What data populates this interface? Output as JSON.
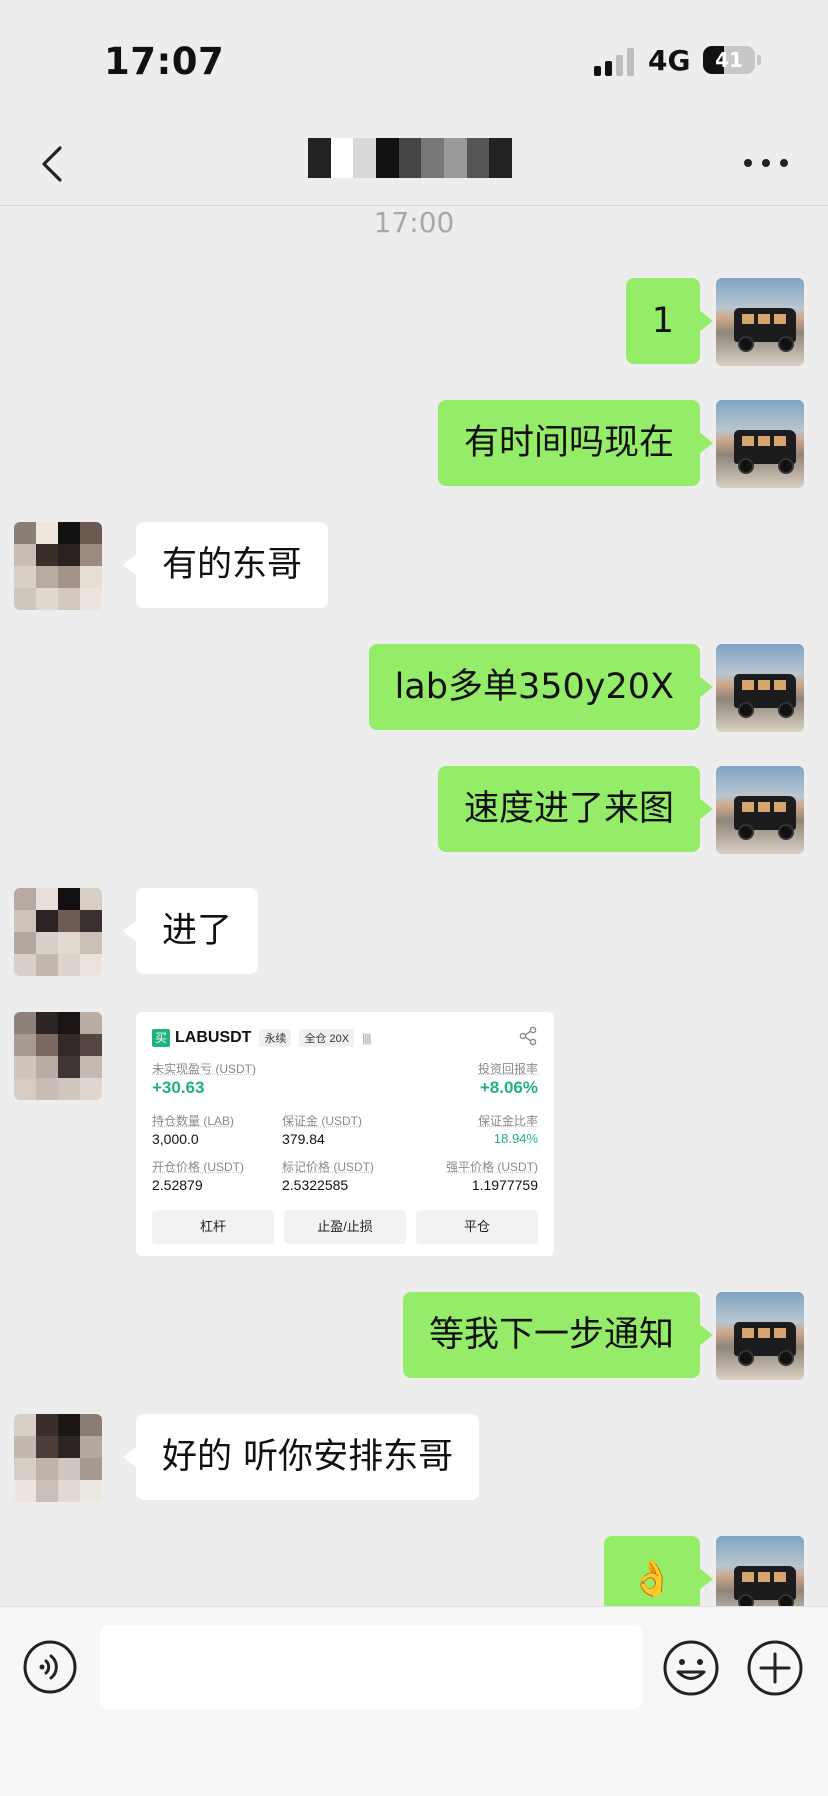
{
  "status_bar": {
    "time": "17:07",
    "network": "4G",
    "battery": "41",
    "battery_level": 0.41
  },
  "header": {
    "back_icon": "chevron-left-icon",
    "more_icon": "more-dots-icon"
  },
  "chat": {
    "timestamp": "17:00",
    "messages": [
      {
        "side": "right",
        "text": "1"
      },
      {
        "side": "right",
        "text": "有时间吗现在"
      },
      {
        "side": "left",
        "text": "有的东哥"
      },
      {
        "side": "right",
        "text": "lab多单350y20X"
      },
      {
        "side": "right",
        "text": "速度进了来图"
      },
      {
        "side": "left",
        "text": "进了"
      },
      {
        "side": "left",
        "type": "trade-card"
      },
      {
        "side": "right",
        "text": "等我下一步通知"
      },
      {
        "side": "left",
        "text": "好的 听你安排东哥"
      },
      {
        "side": "right",
        "text": "👌"
      }
    ]
  },
  "trade_card": {
    "buy_tag": "买",
    "pair": "LABUSDT",
    "tag_perp": "永续",
    "tag_mode": "全仓 20X",
    "bars": "||||",
    "unrealized_label": "未实现盈亏 (USDT)",
    "unrealized_value": "+30.63",
    "roi_label": "投资回报率",
    "roi_value": "+8.06%",
    "qty_label": "持仓数量 (LAB)",
    "qty_value": "3,000.0",
    "margin_label": "保证金 (USDT)",
    "margin_value": "379.84",
    "margin_ratio_label": "保证金比率",
    "margin_ratio_value": "18.94%",
    "entry_label": "开仓价格 (USDT)",
    "entry_value": "2.52879",
    "mark_label": "标记价格 (USDT)",
    "mark_value": "2.5322585",
    "liq_label": "强平价格 (USDT)",
    "liq_value": "1.1977759",
    "btn_leverage": "杠杆",
    "btn_tpsl": "止盈/止损",
    "btn_close": "平仓"
  },
  "input_bar": {
    "voice_icon": "voice-icon",
    "emoji_icon": "emoji-icon",
    "plus_icon": "plus-icon"
  }
}
